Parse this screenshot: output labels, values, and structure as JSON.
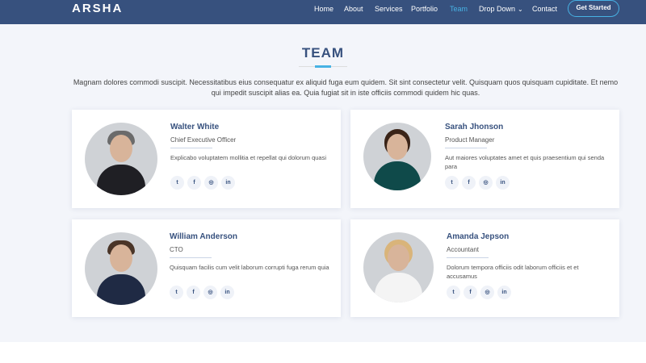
{
  "header": {
    "logo": "ARSHA",
    "nav": [
      "Home",
      "About",
      "Services",
      "Portfolio",
      "Team",
      "Drop Down",
      "Contact"
    ],
    "active": "Team",
    "cta": "Get Started"
  },
  "section": {
    "title": "TEAM",
    "subtitle": "Magnam dolores commodi suscipit. Necessitatibus eius consequatur ex aliquid fuga eum quidem. Sit sint consectetur velit. Quisquam quos quisquam cupiditate. Et nemo qui impedit suscipit alias ea. Quia fugiat sit in iste officiis commodi quidem hic quas."
  },
  "team": [
    {
      "name": "Walter White",
      "role": "Chief Executive Officer",
      "desc": "Explicabo voluptatem mollitia et repellat qui dolorum quasi"
    },
    {
      "name": "Sarah Jhonson",
      "role": "Product Manager",
      "desc": "Aut maiores voluptates amet et quis praesentium qui senda para"
    },
    {
      "name": "William Anderson",
      "role": "CTO",
      "desc": "Quisquam facilis cum velit laborum corrupti fuga rerum quia"
    },
    {
      "name": "Amanda Jepson",
      "role": "Accountant",
      "desc": "Dolorum tempora officiis odit laborum officiis et et accusamus"
    }
  ],
  "social_icons": [
    "twitter-icon",
    "facebook-icon",
    "instagram-icon",
    "linkedin-icon"
  ],
  "colors": {
    "header_bg": "#37517e",
    "accent": "#47b2e4",
    "section_bg": "#f3f5fa",
    "heading": "#37517e"
  }
}
